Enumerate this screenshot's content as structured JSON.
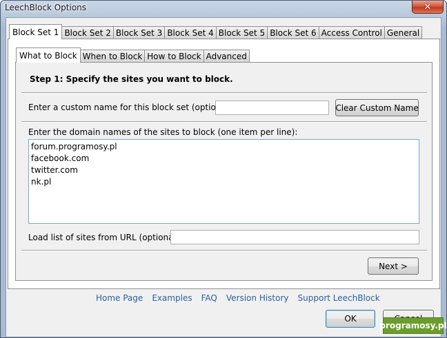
{
  "window": {
    "title": "LeechBlock Options",
    "close_glyph": "✕"
  },
  "outer_tabs": [
    "Block Set 1",
    "Block Set 2",
    "Block Set 3",
    "Block Set 4",
    "Block Set 5",
    "Block Set 6",
    "Access Control",
    "General"
  ],
  "inner_tabs": [
    "What to Block",
    "When to Block",
    "How to Block",
    "Advanced"
  ],
  "step": {
    "title": "Step 1: Specify the sites you want to block."
  },
  "custom_name": {
    "label": "Enter a custom name for this block set (optional):",
    "value": "",
    "clear_button": "Clear Custom Name"
  },
  "sites": {
    "label": "Enter the domain names of the sites to block (one item per line):",
    "items": [
      "forum.programosy.pl",
      "facebook.com",
      "twitter.com",
      "nk.pl"
    ]
  },
  "url_load": {
    "label": "Load list of sites from URL (optional):",
    "value": ""
  },
  "next_button": "Next >",
  "links": [
    "Home Page",
    "Examples",
    "FAQ",
    "Version History",
    "Support LeechBlock"
  ],
  "ok_button": "OK",
  "cancel_button": "Cancel",
  "watermark": "programosy.pl",
  "colors": {
    "titlebar": "#b9c9dc",
    "close": "#c13a1f",
    "link": "#2b5f9e",
    "watermark": "#6c9d2c"
  }
}
